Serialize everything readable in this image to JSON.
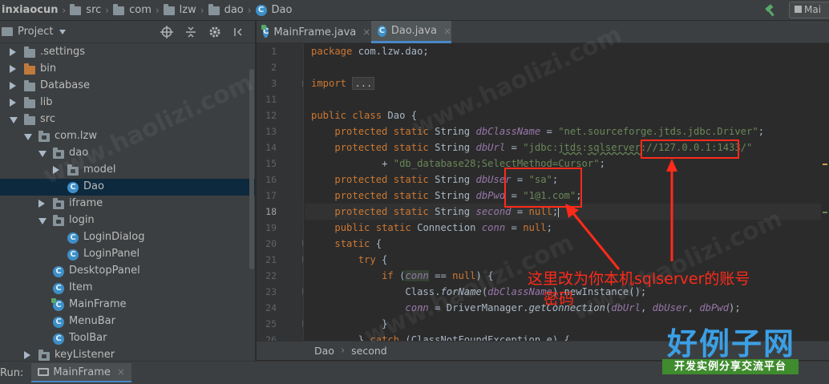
{
  "breadcrumb": [
    "inxiaocun",
    "src",
    "com",
    "lzw",
    "dao",
    "Dao"
  ],
  "run_config_label": "Mai",
  "project_panel": {
    "title": "Project",
    "tree": [
      {
        "label": ".settings",
        "icon": "folder",
        "expand": "right"
      },
      {
        "label": "bin",
        "icon": "folder-orange",
        "expand": "right"
      },
      {
        "label": "Database",
        "icon": "folder",
        "expand": "right"
      },
      {
        "label": "lib",
        "icon": "folder",
        "expand": "right"
      },
      {
        "label": "src",
        "icon": "folder",
        "expand": "down"
      },
      {
        "label": "com.lzw",
        "icon": "package",
        "expand": "down"
      },
      {
        "label": "dao",
        "icon": "package",
        "expand": "down"
      },
      {
        "label": "model",
        "icon": "package",
        "expand": "right"
      },
      {
        "label": "Dao",
        "icon": "class",
        "expand": "none"
      },
      {
        "label": "iframe",
        "icon": "package",
        "expand": "right"
      },
      {
        "label": "login",
        "icon": "package",
        "expand": "down"
      },
      {
        "label": "LoginDialog",
        "icon": "class",
        "expand": "none"
      },
      {
        "label": "LoginPanel",
        "icon": "class",
        "expand": "none"
      },
      {
        "label": "DesktopPanel",
        "icon": "class",
        "expand": "none"
      },
      {
        "label": "Item",
        "icon": "class",
        "expand": "none"
      },
      {
        "label": "MainFrame",
        "icon": "class-main",
        "expand": "none"
      },
      {
        "label": "MenuBar",
        "icon": "class",
        "expand": "none"
      },
      {
        "label": "ToolBar",
        "icon": "class",
        "expand": "none"
      },
      {
        "label": "keyListener",
        "icon": "package",
        "expand": "right"
      }
    ]
  },
  "editor": {
    "tabs": [
      {
        "label": "MainFrame.java",
        "close": "×",
        "active": false
      },
      {
        "label": "Dao.java",
        "close": "×",
        "active": true
      }
    ],
    "line_numbers": [
      "1",
      "2",
      "3",
      "11",
      "12",
      "13",
      "14",
      "15",
      "16",
      "17",
      "18",
      "19",
      "20",
      "21",
      "22",
      "23",
      "24",
      "25",
      "26"
    ],
    "current_line": "18",
    "code": {
      "l1_kw": "package",
      "l1_rest": " com.lzw.dao;",
      "l3_kw": "import",
      "l3_fold": "...",
      "l12_a": "public",
      "l12_b": " class",
      "l12_c": " Dao {",
      "protected": "protected",
      "static": " static",
      "string": " String ",
      "l13_field": "dbClassName",
      "l13_str": "\"net.sourceforge.jtds.jdbc.Driver\"",
      "l14_field": "dbUrl",
      "l14_str_a": "\"jdbc:",
      "l14_str_b": "jtds",
      "l14_str_c": ":",
      "l14_str_d": "sqlserver",
      "l14_str_e": "://127.0.0.1:1433/\"",
      "l15_plus": "+ ",
      "l15_str": "\"db_database28;SelectMethod=Cursor\"",
      "l16_field": "dbUser",
      "l16_str": "\"sa\"",
      "l17_field": "dbPwd",
      "l17_str": "\"1@1.com\"",
      "l18_field": "second",
      "l18_null": "null",
      "l19_a": "public",
      "l19_b": " static",
      "l19_c": " Connection ",
      "l19_field": "conn",
      "l19_null": "null",
      "l20_kw": "static",
      "l20_rest": " {",
      "l21_kw": "try",
      "l21_rest": " {",
      "l22_kw": "if",
      "l22_field": "conn",
      "l22_op": " == ",
      "l22_null": "null",
      "l22_rest": ") {",
      "l23_a": "Class.",
      "l23_m": "forName",
      "l23_field": "dbClassName",
      "l23_rest": ").newInstance();",
      "l24_field": "conn",
      "l24_mid": " = DriverManager.",
      "l24_m": "getConnection",
      "l24_f1": "dbUrl",
      "l24_f2": "dbUser",
      "l24_f3": "dbPwd",
      "l24_rest": ");",
      "l25": "}",
      "l26_a": "} ",
      "l26_kw": "catch",
      "l26_rest": " (ClassNotFoundException e) {"
    },
    "breadcrumb": [
      "Dao",
      "second"
    ]
  },
  "run_bar": {
    "label": "Run:",
    "tab": "MainFrame"
  },
  "annotation": {
    "line1": "这里改为你本机sqlserver的账号",
    "line2": "密码",
    "color": "#ff2a1a"
  },
  "watermark": {
    "title": "好例子网",
    "subtitle": "开发实例分享交流平台",
    "diagonal_text": "www.haolizi.com"
  }
}
